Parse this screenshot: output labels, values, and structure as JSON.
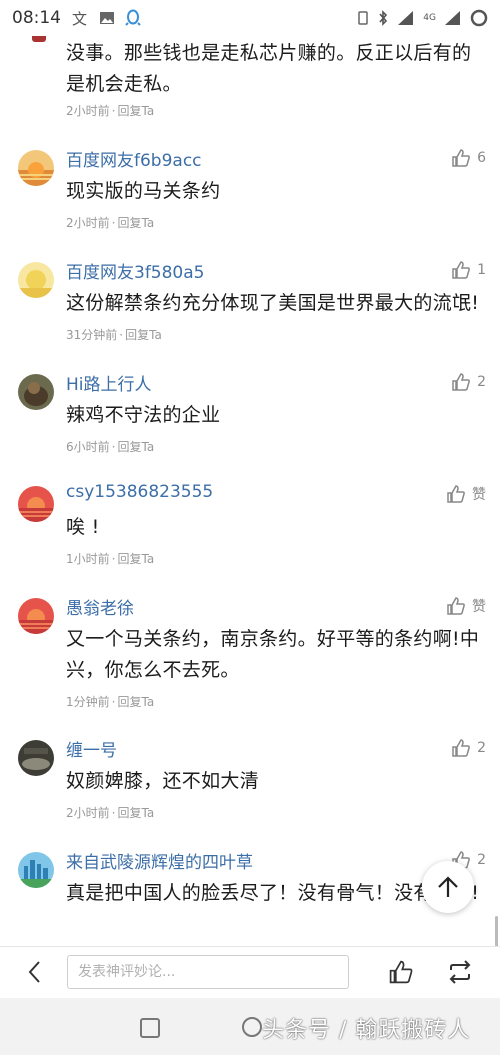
{
  "status_bar": {
    "time": "08:14",
    "network": "4G"
  },
  "partial_comment": {
    "text": "没事。那些钱也是走私芯片赚的。反正以后有的是机会走私。",
    "meta_time": "2小时前",
    "reply": "回复Ta"
  },
  "comments": [
    {
      "name": "百度网友f6b9acc",
      "likes": "6",
      "text": "现实版的马关条约",
      "time": "2小时前",
      "reply": "回复Ta",
      "avatar": "sunset"
    },
    {
      "name": "百度网友3f580a5",
      "likes": "1",
      "text": "这份解禁条约充分体现了美国是世界最大的流氓!",
      "time": "31分钟前",
      "reply": "回复Ta",
      "avatar": "sun-yellow"
    },
    {
      "name": "Hi路上行人",
      "likes": "2",
      "text": "辣鸡不守法的企业",
      "time": "6小时前",
      "reply": "回复Ta",
      "avatar": "photo-brown"
    },
    {
      "name": "csy15386823555",
      "likes": "赞",
      "text": "唉 !",
      "time": "1小时前",
      "reply": "回复Ta",
      "avatar": "sunset-red"
    },
    {
      "name": "愚翁老徐",
      "likes": "赞",
      "text": "又一个马关条约，南京条约。好平等的条约啊!中兴，你怎么不去死。",
      "time": "1分钟前",
      "reply": "回复Ta",
      "avatar": "sunset-red"
    },
    {
      "name": "缠一号",
      "likes": "2",
      "text": "奴颜婢膝，还不如大清",
      "time": "2小时前",
      "reply": "回复Ta",
      "avatar": "photo-dark"
    },
    {
      "name": "来自武陵源辉煌的四叶草",
      "likes": "2",
      "text": "真是把中国人的脸丢尽了！没有骨气！没有尊严!",
      "time": "",
      "reply": "",
      "avatar": "city-blue"
    }
  ],
  "bottom_bar": {
    "input_placeholder": "发表神评妙论..."
  },
  "watermark": "头条号 / 翰跃搬砖人",
  "colors": {
    "username": "#3c6ea8",
    "meta": "#999999",
    "text": "#1c1c1c"
  }
}
